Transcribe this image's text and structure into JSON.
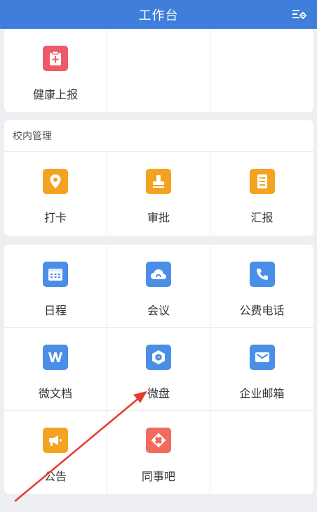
{
  "header": {
    "title": "工作台",
    "settings_icon": "settings-list-icon"
  },
  "top_section": {
    "items": [
      {
        "label": "健康上报",
        "icon": "health-report-icon",
        "color": "#ef5a6a"
      }
    ]
  },
  "campus_section": {
    "title": "校内管理",
    "items": [
      {
        "label": "打卡",
        "icon": "location-pin-icon",
        "color": "#f3a321"
      },
      {
        "label": "审批",
        "icon": "stamp-icon",
        "color": "#f3a321"
      },
      {
        "label": "汇报",
        "icon": "report-doc-icon",
        "color": "#f3a321"
      }
    ]
  },
  "apps_section": {
    "items": [
      {
        "label": "日程",
        "icon": "calendar-icon",
        "color": "#4a8ee8"
      },
      {
        "label": "会议",
        "icon": "cloud-meeting-icon",
        "color": "#4a8ee8"
      },
      {
        "label": "公费电话",
        "icon": "phone-icon",
        "color": "#4a8ee8"
      },
      {
        "label": "微文档",
        "icon": "document-w-icon",
        "color": "#4a8ee8"
      },
      {
        "label": "微盘",
        "icon": "drive-icon",
        "color": "#4a8ee8"
      },
      {
        "label": "企业邮箱",
        "icon": "mail-icon",
        "color": "#4a8ee8"
      },
      {
        "label": "公告",
        "icon": "megaphone-icon",
        "color": "#f3a321"
      },
      {
        "label": "同事吧",
        "icon": "colleague-icon",
        "color": "#f26a5d"
      }
    ]
  },
  "annotation": {
    "arrow_color": "#e8392f"
  }
}
